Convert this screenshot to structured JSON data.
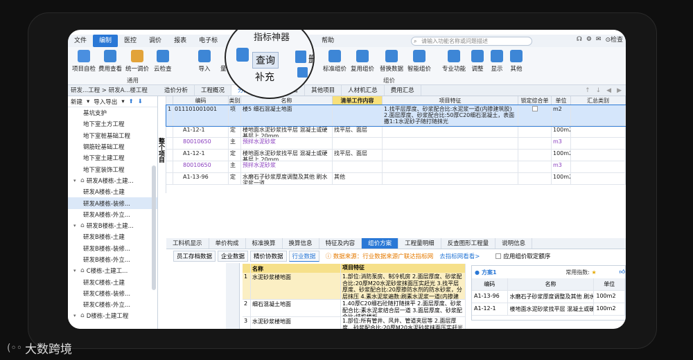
{
  "menubar": {
    "items": [
      "文件",
      "编制",
      "医控",
      "调价",
      "报表",
      "电子标",
      "审核",
      "协作"
    ],
    "extra_items": [
      "帮助"
    ],
    "search_placeholder": "请输入功能名称或问题描述",
    "right_label": "检查"
  },
  "ribbon": {
    "buttons": [
      "项目自检",
      "费用查看",
      "统一调价",
      "云检查",
      "导入",
      "量价一体化",
      "标准组价",
      "复用组价",
      "替换数据",
      "智能组价",
      "专业功能",
      "调整",
      "显示",
      "其他"
    ],
    "groups": [
      "通用",
      "组价"
    ]
  },
  "magnifier": {
    "title": "指标神器",
    "query_label": "查询",
    "fill_label": "补充",
    "delete_label": "删"
  },
  "breadcrumb": "研发...工程 > 研发A...楼工程",
  "tabs": [
    "造价分析",
    "工程概况",
    "分部分项",
    "措施项目",
    "其他项目",
    "人材机汇总",
    "费用汇总"
  ],
  "active_tab": "分部分项",
  "sidebar": {
    "toolbar": [
      "新建",
      "导入导出"
    ],
    "items": [
      {
        "label": "基坑支护",
        "level": 3
      },
      {
        "label": "地下室土方工程",
        "level": 3
      },
      {
        "label": "地下室桩基础工程",
        "level": 3
      },
      {
        "label": "钢筋砼基础工程",
        "level": 3
      },
      {
        "label": "地下室土建工程",
        "level": 3
      },
      {
        "label": "地下室装饰工程",
        "level": 3
      },
      {
        "label": "研发A楼栋-土建...",
        "level": 2,
        "home": true
      },
      {
        "label": "研发A楼栋-土建",
        "level": 3
      },
      {
        "label": "研发A楼栋-装修...",
        "level": 3,
        "selected": true
      },
      {
        "label": "研发A楼栋-外立...",
        "level": 3
      },
      {
        "label": "研发B楼栋-土建...",
        "level": 2,
        "home": true
      },
      {
        "label": "研发B楼栋-土建",
        "level": 3
      },
      {
        "label": "研发B楼栋-装修...",
        "level": 3
      },
      {
        "label": "研发B楼栋-外立...",
        "level": 3
      },
      {
        "label": "C楼栋-土建工...",
        "level": 2,
        "home": true
      },
      {
        "label": "研发C楼栋-土建",
        "level": 3
      },
      {
        "label": "研发C楼栋-装修...",
        "level": 3
      },
      {
        "label": "研发C楼栋-外立...",
        "level": 3
      },
      {
        "label": "D楼栋-土建工程",
        "level": 2,
        "home": true
      }
    ]
  },
  "side_label": "整个项目",
  "grid": {
    "headers": [
      "",
      "编码",
      "类别",
      "名称",
      "清单工作内容",
      "项目特征",
      "锁定综合单价",
      "单位",
      "汇总类别"
    ],
    "rows": [
      {
        "idx": "1",
        "code": "011101001001",
        "type": "项",
        "name": "楼5 细石混凝土地面",
        "work": "",
        "feature": "1.找平层厚度、砂浆配合比:水泥浆一道(内掺建筑胶) 2.面层厚度、砂浆配合比:50厚C20细石混凝土，表面撒1:1水泥砂子随打随抹光",
        "unit": "m2",
        "selected": true,
        "check": true
      },
      {
        "idx": "",
        "code": "A1-12-1",
        "type": "定",
        "name": "楼地面水泥砂浆找平层 混凝土或硬基层上 20mm",
        "work": "找平层、面层",
        "feature": "",
        "unit": "100m2"
      },
      {
        "idx": "",
        "code": "80010650",
        "type": "主",
        "name": "预拌水泥砂浆",
        "work": "",
        "feature": "",
        "unit": "m3",
        "purple": true
      },
      {
        "idx": "",
        "code": "A1-12-1",
        "type": "定",
        "name": "楼地面水泥砂浆找平层 混凝土或硬基层上 20mm",
        "work": "找平层、面层",
        "feature": "",
        "unit": "100m2"
      },
      {
        "idx": "",
        "code": "80010650",
        "type": "主",
        "name": "预拌水泥砂浆",
        "work": "",
        "feature": "",
        "unit": "m3",
        "purple": true
      },
      {
        "idx": "",
        "code": "A1-13-96",
        "type": "定",
        "name": "水磨石子砂浆厚度调整及其他 刷水泥浆一道",
        "work": "其他",
        "feature": "",
        "unit": "100m2"
      }
    ]
  },
  "bottom_tabs": [
    "工料机显示",
    "单价构成",
    "标准换算",
    "换算信息",
    "特征及内容",
    "组价方案",
    "工程量明细",
    "反查图形工程量",
    "说明信息"
  ],
  "active_bottom_tab": "组价方案",
  "subtabs": [
    "员工存档数据",
    "企业数据",
    "精价协数据",
    "行业数据"
  ],
  "active_subtab": "行业数据",
  "info_text": "数据来源：行业数据来源广联达指标网",
  "jump_text": "去指标网看看>",
  "apply_label": "应用组价取定额序",
  "left_table": {
    "headers": [
      "",
      "名称",
      "项目特征"
    ],
    "rows": [
      {
        "idx": "1",
        "name": "水泥砂浆楼地面",
        "feature": "1.部位:消防泵房、制冷机房 2.面层厚度、砂浆配合比:20厚M20水泥砂浆抹面压实赶光 3.找平层厚度、砂浆配合比:20厚掺防水剂的防水砂浆，分层抹压 4.素水泥浆遍数:刷素水泥浆一道(内掺建筑胶)",
        "selected": true
      },
      {
        "idx": "2",
        "name": "细石混凝土地面",
        "feature": "1.40厚C20细石砼随打随抹平 2.面层厚度、砂浆配合比:素水泥浆结合层一道 3.面层厚度、砂浆配合比:结构楼板"
      },
      {
        "idx": "3",
        "name": "水泥砂浆楼地面",
        "feature": "1.部位:所有管井、风井、管道夹层等 2.面层厚度、砂浆配合比:20厚M20水泥砂浆抹面压实赶光"
      }
    ]
  },
  "right_panel": {
    "title": "方案1",
    "freq_label": "常用指数:",
    "headers": [
      "编码",
      "名称",
      "单位"
    ],
    "rows": [
      {
        "code": "A1-13-96",
        "name": "水磨石子砂浆厚度调整及其他 刷水泥浆一道",
        "unit": "100m2"
      },
      {
        "code": "A1-12-1",
        "name": "楼地面水泥砂浆找平层 混凝土或硬基层上 20mm",
        "unit": "100m2"
      }
    ]
  },
  "logo_text": "大数跨境"
}
